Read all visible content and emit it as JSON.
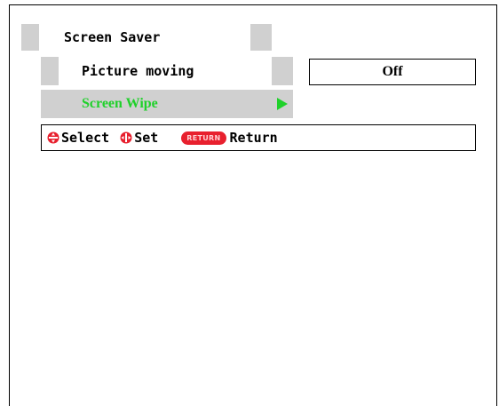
{
  "title": "Screen Saver",
  "menu": {
    "picture_moving": {
      "label": "Picture moving",
      "value": "Off"
    },
    "screen_wipe": {
      "label": "Screen Wipe"
    }
  },
  "help": {
    "select_label": "Select",
    "set_label": "Set",
    "return_badge": "RETURN",
    "return_label": "Return"
  },
  "colors": {
    "highlight_text": "#1fd12a",
    "panel_gray": "#d0d0d0",
    "badge_red": "#e8202e"
  }
}
